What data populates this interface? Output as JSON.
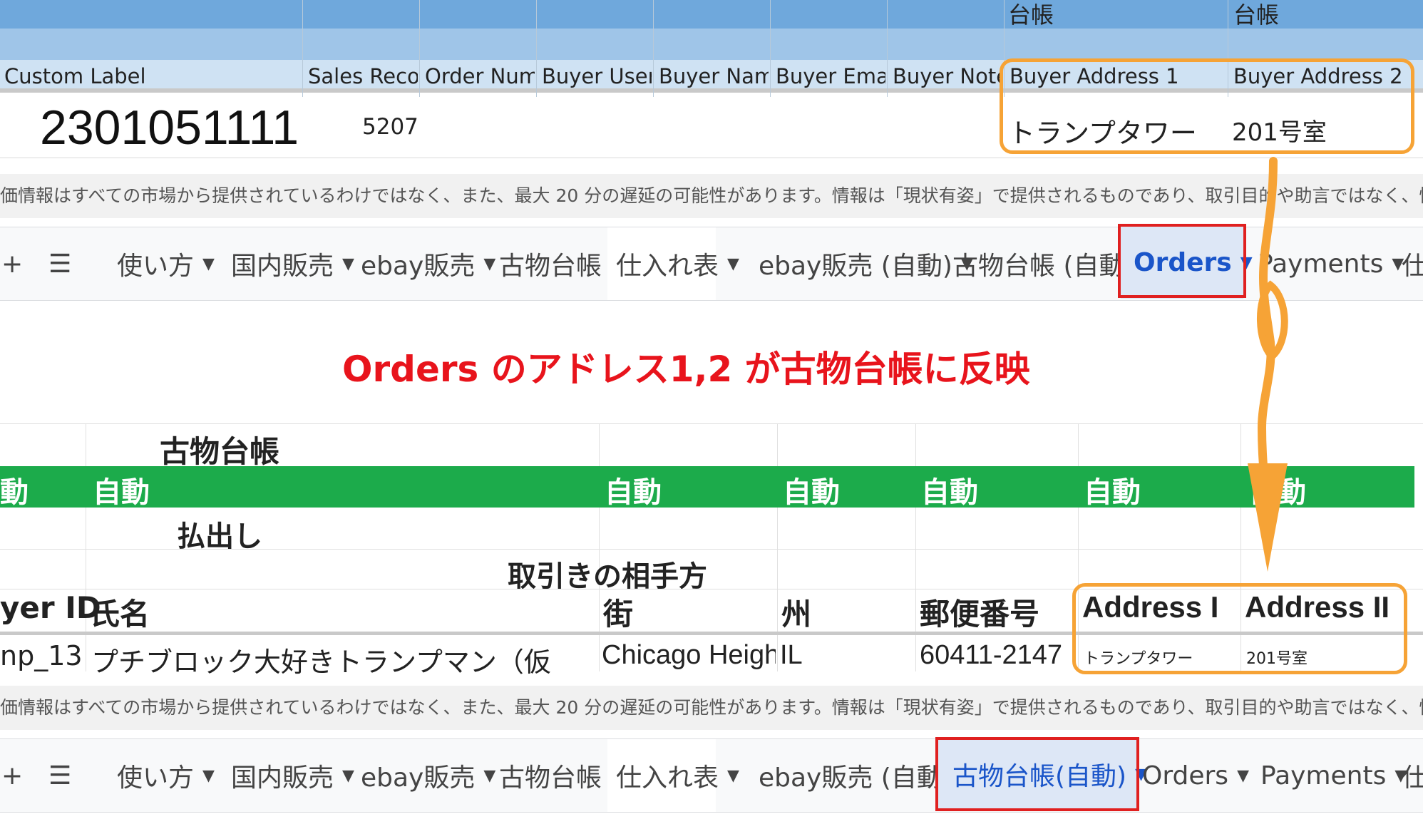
{
  "orders_sheet": {
    "band_labels": [
      "台帳",
      "台帳"
    ],
    "headers": [
      "Custom Label",
      "Sales Recor",
      "Order Num",
      "Buyer User",
      "Buyer Nam",
      "Buyer Emai",
      "Buyer Note",
      "Buyer Address 1",
      "Buyer Address 2"
    ],
    "row": {
      "custom_label": "2301051111",
      "sales_record": "5207",
      "buyer_address_1": "トランプタワー",
      "buyer_address_2": "201号室"
    }
  },
  "disclaimer_text": "価情報はすべての市場から提供されているわけではなく、また、最大 20 分の遅延の可能性があります。情報は「現状有姿」で提供されるものであり、取引目的や助言ではなく、情報提供のみを目的として提供されています。免",
  "tabs_top": {
    "add": "+",
    "menu": "☰",
    "items": [
      "使い方",
      "国内販売",
      "ebay販売",
      "古物台帳",
      "仕入れ表",
      "ebay販売 (自動)",
      "古物台帳 (自動)",
      "Orders",
      "Payments",
      "仕"
    ],
    "active": "Orders"
  },
  "caption": "Orders のアドレス1,2 が古物台帳に反映",
  "ledger_sheet": {
    "title": "古物台帳",
    "auto_label": "自動",
    "auto_left_partial": "動",
    "row_payout": "払出し",
    "row_counterparty": "取引きの相手方",
    "headers": [
      "yer ID",
      "氏名",
      "街",
      "州",
      "郵便番号",
      "Address I",
      "Address II"
    ],
    "row": {
      "buyer_id": "np_13",
      "name": "プチブロック大好きトランプマン（仮",
      "city": "Chicago Heigh",
      "state": "IL",
      "zip": "60411-2147",
      "address_1": "トランプタワー",
      "address_2": "201号室"
    }
  },
  "tabs_bottom": {
    "add": "+",
    "menu": "☰",
    "items": [
      "使い方",
      "国内販売",
      "ebay販売",
      "古物台帳",
      "仕入れ表",
      "ebay販売 (自動)",
      "古物台帳(自動)",
      "Orders",
      "Payments",
      "仕"
    ],
    "active": "古物台帳(自動)"
  },
  "colors": {
    "highlight_red": "#e02020",
    "highlight_orange": "#f6a336",
    "caption_red": "#e8141c",
    "auto_green": "#1cab4b",
    "active_tab_text": "#1a55c9"
  }
}
